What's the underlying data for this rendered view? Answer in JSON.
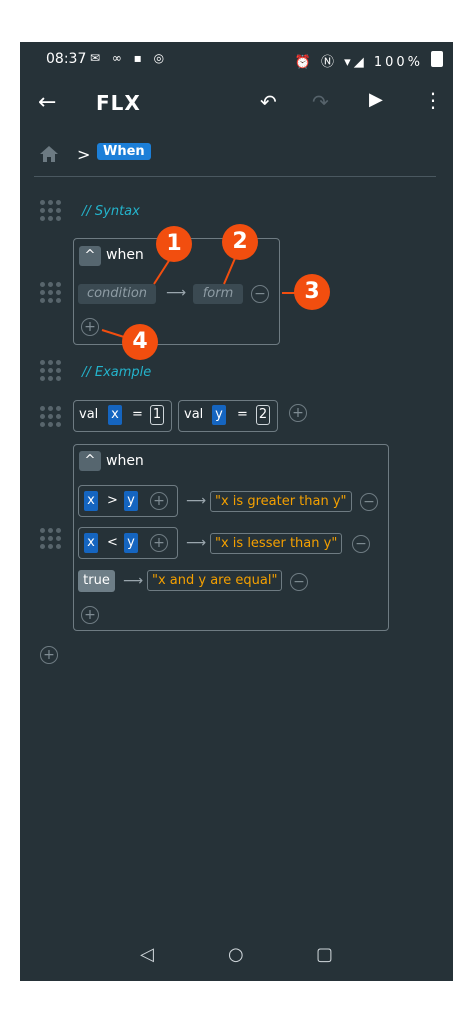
{
  "status": {
    "time": "08:37",
    "battery": "100%"
  },
  "appbar": {
    "title": "FLX"
  },
  "breadcrumb": {
    "current": "When"
  },
  "syntax": {
    "comment": "// Syntax",
    "keyword": "when",
    "condition": "condition",
    "form": "form",
    "markers": [
      "1",
      "2",
      "3",
      "4"
    ]
  },
  "example": {
    "comment": "// Example",
    "val1": {
      "kw": "val",
      "name": "x",
      "eq": "=",
      "value": "1"
    },
    "val2": {
      "kw": "val",
      "name": "y",
      "eq": "=",
      "value": "2"
    },
    "keyword": "when",
    "row1": {
      "a": "x",
      "op": ">",
      "b": "y",
      "result": "\"x is greater than y\""
    },
    "row2": {
      "a": "x",
      "op": "<",
      "b": "y",
      "result": "\"x is lesser than y\""
    },
    "row3": {
      "cond": "true",
      "result": "\"x and y are equal\""
    }
  }
}
